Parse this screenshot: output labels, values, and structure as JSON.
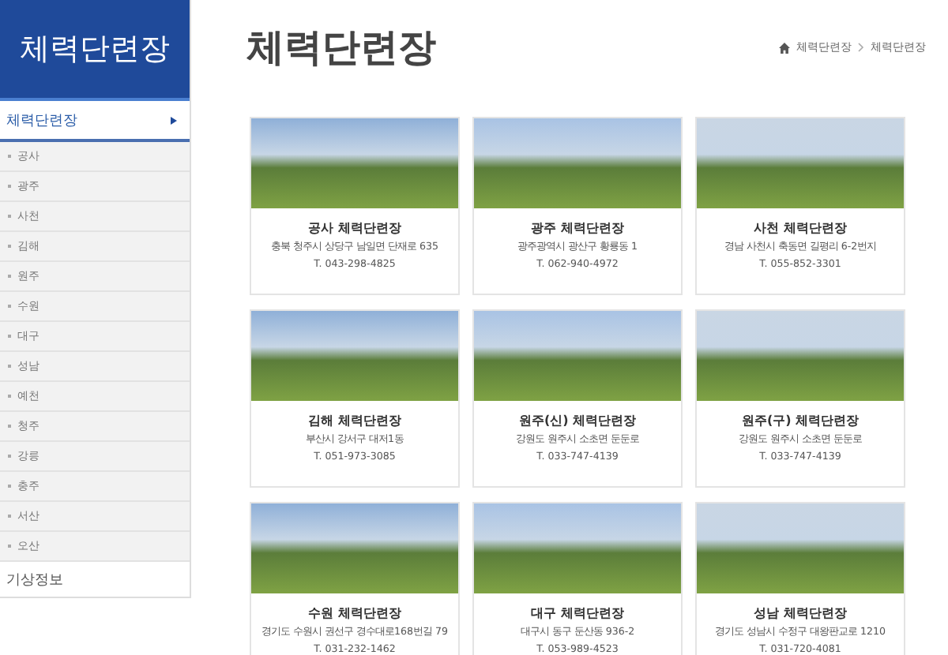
{
  "sidebar": {
    "title": "체력단련장",
    "menu": {
      "label": "체력단련장",
      "expanded": true,
      "children": [
        {
          "label": "공사"
        },
        {
          "label": "광주"
        },
        {
          "label": "사천"
        },
        {
          "label": "김해"
        },
        {
          "label": "원주"
        },
        {
          "label": "수원"
        },
        {
          "label": "대구"
        },
        {
          "label": "성남"
        },
        {
          "label": "예천"
        },
        {
          "label": "청주"
        },
        {
          "label": "강릉"
        },
        {
          "label": "충주"
        },
        {
          "label": "서산"
        },
        {
          "label": "오산"
        }
      ]
    },
    "items": [
      {
        "label": "기상정보"
      }
    ]
  },
  "page_title": "체력단련장",
  "breadcrumb": [
    "체력단련장",
    "체력단련장"
  ],
  "cards": [
    {
      "name": "공사 체력단련장",
      "address": "충북 청주시 상당구 남일면 단재로 635",
      "phone": "T. 043-298-4825"
    },
    {
      "name": "광주 체력단련장",
      "address": "광주광역시 광산구 황룡동 1",
      "phone": "T. 062-940-4972"
    },
    {
      "name": "사천 체력단련장",
      "address": "경남 사천시 축동면 길평리 6-2번지",
      "phone": "T. 055-852-3301"
    },
    {
      "name": "김해 체력단련장",
      "address": "부산시 강서구 대저1동",
      "phone": "T. 051-973-3085"
    },
    {
      "name": "원주(신) 체력단련장",
      "address": "강원도 원주시 소초면 둔둔로",
      "phone": "T. 033-747-4139"
    },
    {
      "name": "원주(구) 체력단련장",
      "address": "강원도 원주시 소초면 둔둔로",
      "phone": "T. 033-747-4139"
    },
    {
      "name": "수원 체력단련장",
      "address": "경기도 수원시 권선구 경수대로168번길 79",
      "phone": "T. 031-232-1462"
    },
    {
      "name": "대구 체력단련장",
      "address": "대구시 동구 둔산동 936-2",
      "phone": "T. 053-989-4523"
    },
    {
      "name": "성남 체력단련장",
      "address": "경기도 성남시 수정구 대왕판교로 1210",
      "phone": "T. 031-720-4081"
    }
  ]
}
